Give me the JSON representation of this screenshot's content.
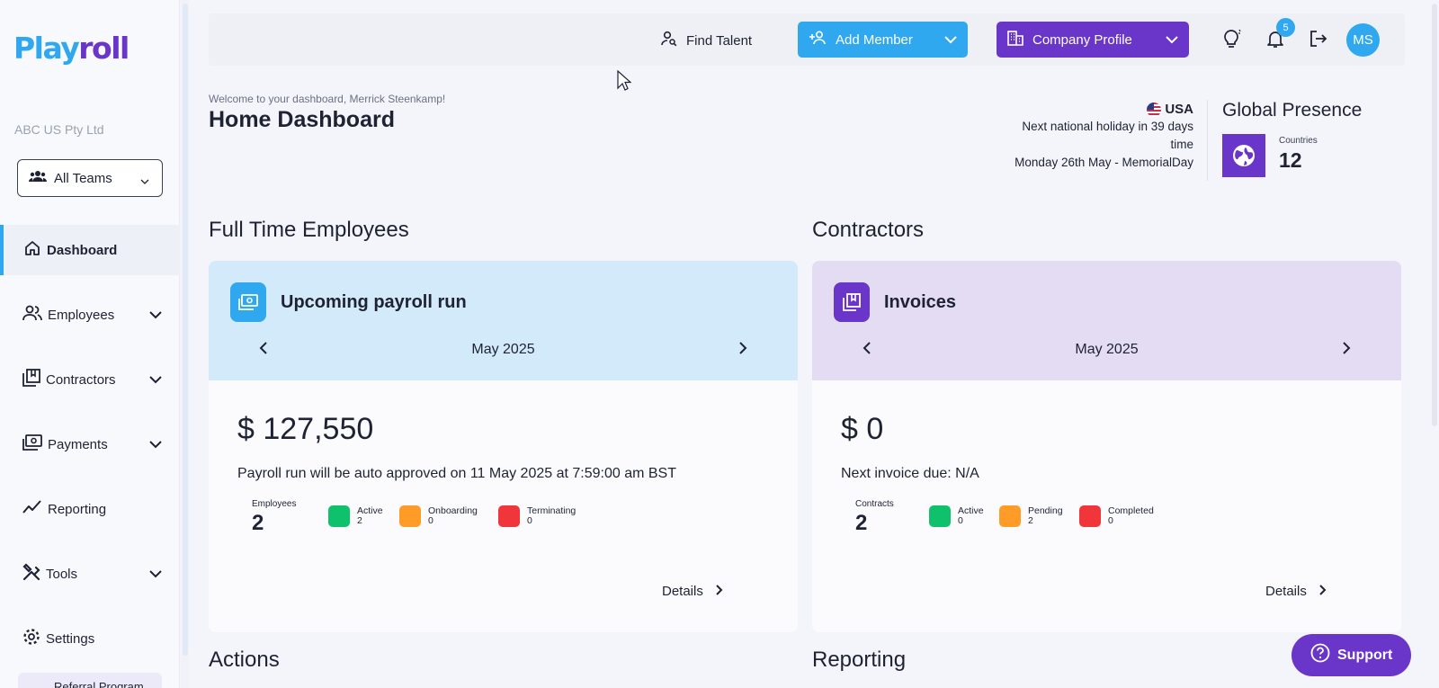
{
  "brand": {
    "logo_part1": "Play",
    "logo_part2": "roll"
  },
  "sidebar": {
    "company": "ABC US Pty Ltd",
    "team_select": "All Teams",
    "items": [
      {
        "label": "Dashboard",
        "icon": "home-icon"
      },
      {
        "label": "Employees",
        "icon": "people-icon"
      },
      {
        "label": "Contractors",
        "icon": "contract-icon"
      },
      {
        "label": "Payments",
        "icon": "payments-icon"
      },
      {
        "label": "Reporting",
        "icon": "trend-icon"
      },
      {
        "label": "Tools",
        "icon": "tools-icon"
      },
      {
        "label": "Settings",
        "icon": "gear-icon"
      }
    ],
    "referral": "Referral Program"
  },
  "topbar": {
    "find_talent": "Find Talent",
    "add_member": "Add Member",
    "company_profile": "Company Profile",
    "notification_count": "5",
    "avatar_initials": "MS"
  },
  "header": {
    "welcome": "Welcome to your dashboard, Merrick Steenkamp!",
    "title": "Home Dashboard",
    "country": "USA",
    "holiday_line1": "Next national holiday in 39 days",
    "holiday_line2": "time",
    "holiday_line3": "Monday 26th May - MemorialDay",
    "global_presence_title": "Global Presence",
    "countries_label": "Countries",
    "countries_value": "12"
  },
  "fte": {
    "section_title": "Full Time Employees",
    "card_title": "Upcoming payroll run",
    "month": "May 2025",
    "amount": "$ 127,550",
    "note": "Payroll run will be auto approved on 11 May 2025 at 7:59:00 am BST",
    "count_label": "Employees",
    "count": "2",
    "legend": [
      {
        "label": "Active",
        "value": "2",
        "color": "#10c16c"
      },
      {
        "label": "Onboarding",
        "value": "0",
        "color": "#ff9c28"
      },
      {
        "label": "Terminating",
        "value": "0",
        "color": "#f0353b"
      }
    ],
    "details": "Details"
  },
  "contractors": {
    "section_title": "Contractors",
    "card_title": "Invoices",
    "month": "May 2025",
    "amount": "$ 0",
    "note": "Next invoice due: N/A",
    "count_label": "Contracts",
    "count": "2",
    "legend": [
      {
        "label": "Active",
        "value": "0",
        "color": "#10c16c"
      },
      {
        "label": "Pending",
        "value": "2",
        "color": "#ff9c28"
      },
      {
        "label": "Completed",
        "value": "0",
        "color": "#f0353b"
      }
    ],
    "details": "Details"
  },
  "sections": {
    "actions": "Actions",
    "reporting": "Reporting"
  },
  "support": "Support",
  "colors": {
    "blue": "#2fa8f0",
    "purple": "#6a35c9",
    "fte_header": "#d3eafb",
    "contractor_header": "#e4dcf2"
  }
}
